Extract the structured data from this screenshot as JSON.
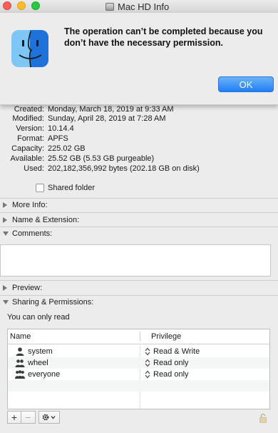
{
  "window": {
    "title": "Mac HD Info"
  },
  "alert": {
    "message": "The operation can’t be completed because you don’t have the necessary permission.",
    "ok_label": "OK"
  },
  "info": {
    "rows": [
      {
        "label": "Created:",
        "value": "Monday, March 18, 2019 at 9:33 AM"
      },
      {
        "label": "Modified:",
        "value": "Sunday, April 28, 2019 at 7:28 AM"
      },
      {
        "label": "Version:",
        "value": "10.14.4"
      },
      {
        "label": "Format:",
        "value": "APFS"
      },
      {
        "label": "Capacity:",
        "value": "225.02 GB"
      },
      {
        "label": "Available:",
        "value": "25.52 GB (5.53 GB purgeable)"
      },
      {
        "label": "Used:",
        "value": "202,182,356,992 bytes (202.18 GB on disk)"
      }
    ],
    "shared_folder_label": "Shared folder",
    "shared_folder_checked": false
  },
  "sections": {
    "more_info": "More Info:",
    "name_extension": "Name & Extension:",
    "comments": "Comments:",
    "preview": "Preview:",
    "sharing": "Sharing & Permissions:"
  },
  "sharing": {
    "status": "You can only read",
    "headers": {
      "name": "Name",
      "privilege": "Privilege"
    },
    "rows": [
      {
        "name": "system",
        "privilege": "Read & Write",
        "icon": "single-user-icon"
      },
      {
        "name": "wheel",
        "privilege": "Read only",
        "icon": "group-icon"
      },
      {
        "name": "everyone",
        "privilege": "Read only",
        "icon": "everyone-icon"
      }
    ]
  },
  "toolbar": {
    "add": "+",
    "remove": "−"
  },
  "colors": {
    "accent": "#1f7ff5",
    "close": "#fc5f57",
    "minimize": "#fdbb2e",
    "zoom": "#28c840"
  }
}
